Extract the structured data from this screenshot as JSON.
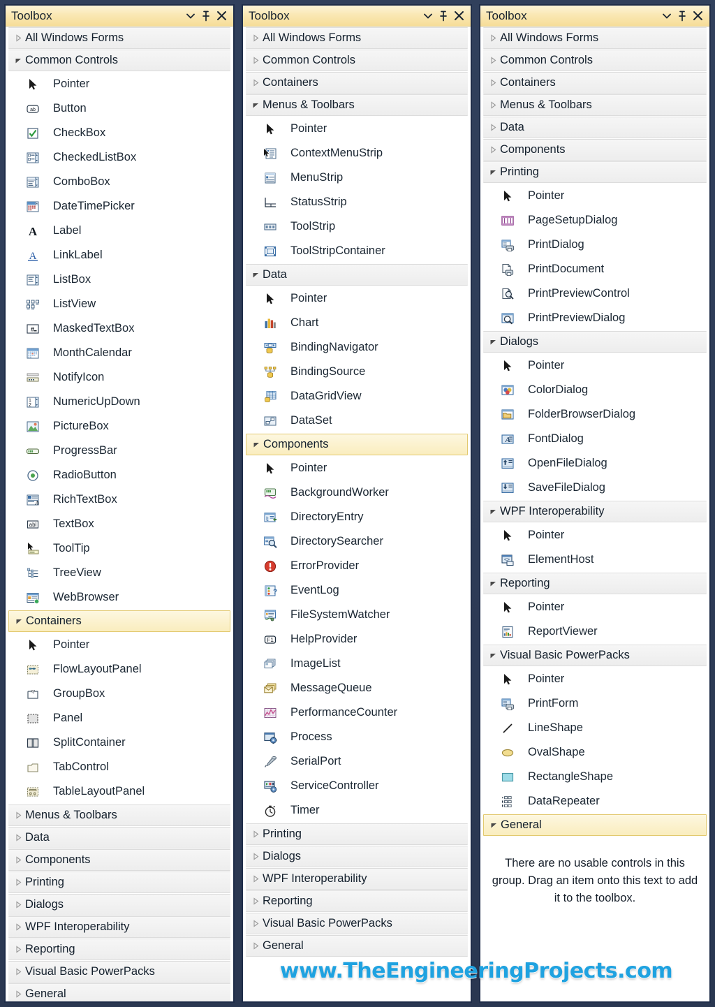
{
  "window": {
    "title": "Toolbox",
    "buttons": {
      "dropdown": "▾",
      "pin": "pin",
      "close": "✕"
    }
  },
  "watermark": "www.TheEngineeringProjects.com",
  "empty_group_message": "There are no usable controls in this group. Drag an item onto this text to add it to the toolbox.",
  "panels": [
    {
      "id": "panel-1",
      "title": "Toolbox",
      "groups": [
        {
          "label": "All Windows Forms",
          "expanded": false,
          "selected": false,
          "items": []
        },
        {
          "label": "Common Controls",
          "expanded": true,
          "selected": false,
          "items": [
            {
              "label": "Pointer",
              "icon": "pointer-icon"
            },
            {
              "label": "Button",
              "icon": "button-icon"
            },
            {
              "label": "CheckBox",
              "icon": "checkbox-icon"
            },
            {
              "label": "CheckedListBox",
              "icon": "checkedlistbox-icon"
            },
            {
              "label": "ComboBox",
              "icon": "combobox-icon"
            },
            {
              "label": "DateTimePicker",
              "icon": "datetimepicker-icon"
            },
            {
              "label": "Label",
              "icon": "label-icon"
            },
            {
              "label": "LinkLabel",
              "icon": "linklabel-icon"
            },
            {
              "label": "ListBox",
              "icon": "listbox-icon"
            },
            {
              "label": "ListView",
              "icon": "listview-icon"
            },
            {
              "label": "MaskedTextBox",
              "icon": "maskedtextbox-icon"
            },
            {
              "label": "MonthCalendar",
              "icon": "monthcalendar-icon"
            },
            {
              "label": "NotifyIcon",
              "icon": "notifyicon-icon"
            },
            {
              "label": "NumericUpDown",
              "icon": "numericupdown-icon"
            },
            {
              "label": "PictureBox",
              "icon": "picturebox-icon"
            },
            {
              "label": "ProgressBar",
              "icon": "progressbar-icon"
            },
            {
              "label": "RadioButton",
              "icon": "radiobutton-icon"
            },
            {
              "label": "RichTextBox",
              "icon": "richtextbox-icon"
            },
            {
              "label": "TextBox",
              "icon": "textbox-icon"
            },
            {
              "label": "ToolTip",
              "icon": "tooltip-icon"
            },
            {
              "label": "TreeView",
              "icon": "treeview-icon"
            },
            {
              "label": "WebBrowser",
              "icon": "webbrowser-icon"
            }
          ]
        },
        {
          "label": "Containers",
          "expanded": true,
          "selected": true,
          "items": [
            {
              "label": "Pointer",
              "icon": "pointer-icon"
            },
            {
              "label": "FlowLayoutPanel",
              "icon": "flowlayoutpanel-icon"
            },
            {
              "label": "GroupBox",
              "icon": "groupbox-icon"
            },
            {
              "label": "Panel",
              "icon": "panel-icon"
            },
            {
              "label": "SplitContainer",
              "icon": "splitcontainer-icon"
            },
            {
              "label": "TabControl",
              "icon": "tabcontrol-icon"
            },
            {
              "label": "TableLayoutPanel",
              "icon": "tablelayoutpanel-icon"
            }
          ]
        },
        {
          "label": "Menus & Toolbars",
          "expanded": false,
          "selected": false,
          "items": []
        },
        {
          "label": "Data",
          "expanded": false,
          "selected": false,
          "items": []
        },
        {
          "label": "Components",
          "expanded": false,
          "selected": false,
          "items": []
        },
        {
          "label": "Printing",
          "expanded": false,
          "selected": false,
          "items": []
        },
        {
          "label": "Dialogs",
          "expanded": false,
          "selected": false,
          "items": []
        },
        {
          "label": "WPF Interoperability",
          "expanded": false,
          "selected": false,
          "items": []
        },
        {
          "label": "Reporting",
          "expanded": false,
          "selected": false,
          "items": []
        },
        {
          "label": "Visual Basic PowerPacks",
          "expanded": false,
          "selected": false,
          "items": []
        },
        {
          "label": "General",
          "expanded": false,
          "selected": false,
          "items": []
        }
      ]
    },
    {
      "id": "panel-2",
      "title": "Toolbox",
      "groups": [
        {
          "label": "All Windows Forms",
          "expanded": false,
          "selected": false,
          "items": []
        },
        {
          "label": "Common Controls",
          "expanded": false,
          "selected": false,
          "items": []
        },
        {
          "label": "Containers",
          "expanded": false,
          "selected": false,
          "items": []
        },
        {
          "label": "Menus & Toolbars",
          "expanded": true,
          "selected": false,
          "items": [
            {
              "label": "Pointer",
              "icon": "pointer-icon"
            },
            {
              "label": "ContextMenuStrip",
              "icon": "contextmenustrip-icon"
            },
            {
              "label": "MenuStrip",
              "icon": "menustrip-icon"
            },
            {
              "label": "StatusStrip",
              "icon": "statusstrip-icon"
            },
            {
              "label": "ToolStrip",
              "icon": "toolstrip-icon"
            },
            {
              "label": "ToolStripContainer",
              "icon": "toolstripcontainer-icon"
            }
          ]
        },
        {
          "label": "Data",
          "expanded": true,
          "selected": false,
          "items": [
            {
              "label": "Pointer",
              "icon": "pointer-icon"
            },
            {
              "label": "Chart",
              "icon": "chart-icon"
            },
            {
              "label": "BindingNavigator",
              "icon": "bindingnavigator-icon"
            },
            {
              "label": "BindingSource",
              "icon": "bindingsource-icon"
            },
            {
              "label": "DataGridView",
              "icon": "datagridview-icon"
            },
            {
              "label": "DataSet",
              "icon": "dataset-icon"
            }
          ]
        },
        {
          "label": "Components",
          "expanded": true,
          "selected": true,
          "items": [
            {
              "label": "Pointer",
              "icon": "pointer-icon"
            },
            {
              "label": "BackgroundWorker",
              "icon": "backgroundworker-icon"
            },
            {
              "label": "DirectoryEntry",
              "icon": "directoryentry-icon"
            },
            {
              "label": "DirectorySearcher",
              "icon": "directorysearcher-icon"
            },
            {
              "label": "ErrorProvider",
              "icon": "errorprovider-icon"
            },
            {
              "label": "EventLog",
              "icon": "eventlog-icon"
            },
            {
              "label": "FileSystemWatcher",
              "icon": "filesystemwatcher-icon"
            },
            {
              "label": "HelpProvider",
              "icon": "helpprovider-icon"
            },
            {
              "label": "ImageList",
              "icon": "imagelist-icon"
            },
            {
              "label": "MessageQueue",
              "icon": "messagequeue-icon"
            },
            {
              "label": "PerformanceCounter",
              "icon": "performancecounter-icon"
            },
            {
              "label": "Process",
              "icon": "process-icon"
            },
            {
              "label": "SerialPort",
              "icon": "serialport-icon"
            },
            {
              "label": "ServiceController",
              "icon": "servicecontroller-icon"
            },
            {
              "label": "Timer",
              "icon": "timer-icon"
            }
          ]
        },
        {
          "label": "Printing",
          "expanded": false,
          "selected": false,
          "items": []
        },
        {
          "label": "Dialogs",
          "expanded": false,
          "selected": false,
          "items": []
        },
        {
          "label": "WPF Interoperability",
          "expanded": false,
          "selected": false,
          "items": []
        },
        {
          "label": "Reporting",
          "expanded": false,
          "selected": false,
          "items": []
        },
        {
          "label": "Visual Basic PowerPacks",
          "expanded": false,
          "selected": false,
          "items": []
        },
        {
          "label": "General",
          "expanded": false,
          "selected": false,
          "items": []
        }
      ]
    },
    {
      "id": "panel-3",
      "title": "Toolbox",
      "groups": [
        {
          "label": "All Windows Forms",
          "expanded": false,
          "selected": false,
          "items": []
        },
        {
          "label": "Common Controls",
          "expanded": false,
          "selected": false,
          "items": []
        },
        {
          "label": "Containers",
          "expanded": false,
          "selected": false,
          "items": []
        },
        {
          "label": "Menus & Toolbars",
          "expanded": false,
          "selected": false,
          "items": []
        },
        {
          "label": "Data",
          "expanded": false,
          "selected": false,
          "items": []
        },
        {
          "label": "Components",
          "expanded": false,
          "selected": false,
          "items": []
        },
        {
          "label": "Printing",
          "expanded": true,
          "selected": false,
          "items": [
            {
              "label": "Pointer",
              "icon": "pointer-icon"
            },
            {
              "label": "PageSetupDialog",
              "icon": "pagesetupdialog-icon"
            },
            {
              "label": "PrintDialog",
              "icon": "printdialog-icon"
            },
            {
              "label": "PrintDocument",
              "icon": "printdocument-icon"
            },
            {
              "label": "PrintPreviewControl",
              "icon": "printpreviewcontrol-icon"
            },
            {
              "label": "PrintPreviewDialog",
              "icon": "printpreviewdialog-icon"
            }
          ]
        },
        {
          "label": "Dialogs",
          "expanded": true,
          "selected": false,
          "items": [
            {
              "label": "Pointer",
              "icon": "pointer-icon"
            },
            {
              "label": "ColorDialog",
              "icon": "colordialog-icon"
            },
            {
              "label": "FolderBrowserDialog",
              "icon": "folderbrowserdialog-icon"
            },
            {
              "label": "FontDialog",
              "icon": "fontdialog-icon"
            },
            {
              "label": "OpenFileDialog",
              "icon": "openfiledialog-icon"
            },
            {
              "label": "SaveFileDialog",
              "icon": "savefiledialog-icon"
            }
          ]
        },
        {
          "label": "WPF Interoperability",
          "expanded": true,
          "selected": false,
          "items": [
            {
              "label": "Pointer",
              "icon": "pointer-icon"
            },
            {
              "label": "ElementHost",
              "icon": "elementhost-icon"
            }
          ]
        },
        {
          "label": "Reporting",
          "expanded": true,
          "selected": false,
          "items": [
            {
              "label": "Pointer",
              "icon": "pointer-icon"
            },
            {
              "label": "ReportViewer",
              "icon": "reportviewer-icon"
            }
          ]
        },
        {
          "label": "Visual Basic PowerPacks",
          "expanded": true,
          "selected": false,
          "items": [
            {
              "label": "Pointer",
              "icon": "pointer-icon"
            },
            {
              "label": "PrintForm",
              "icon": "printform-icon"
            },
            {
              "label": "LineShape",
              "icon": "lineshape-icon"
            },
            {
              "label": "OvalShape",
              "icon": "ovalshape-icon"
            },
            {
              "label": "RectangleShape",
              "icon": "rectangleshape-icon"
            },
            {
              "label": "DataRepeater",
              "icon": "datarepeater-icon"
            }
          ]
        },
        {
          "label": "General",
          "expanded": true,
          "selected": true,
          "empty": true,
          "items": []
        }
      ]
    }
  ],
  "colors": {
    "desktop": "#2b3a55",
    "panel_border": "#1f2d49",
    "titlebar_top": "#fdf4d8",
    "titlebar_bottom": "#f6dd98",
    "category_bg": "#f1f1f1",
    "category_selected_bg": "#faedbe",
    "category_selected_border": "#e2c96f",
    "text": "#1b2733",
    "watermark": "#1fa2e0"
  }
}
